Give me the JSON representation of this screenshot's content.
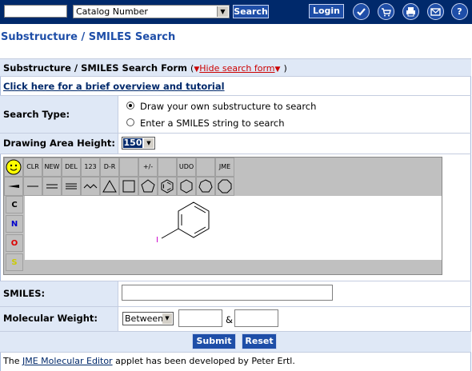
{
  "topbar": {
    "search_value": "",
    "catalog_select": "Catalog Number",
    "search_button": "Search",
    "login_button": "Login",
    "icons": [
      "check-icon",
      "cart-icon",
      "print-icon",
      "mail-icon",
      "help-icon"
    ],
    "help_glyph": "?"
  },
  "page": {
    "title": "Substructure / SMILES Search"
  },
  "form": {
    "header_title": "Substructure / SMILES Search Form",
    "header_open_paren": "(",
    "hide_link": "Hide search form",
    "header_close_paren": ")",
    "tutorial_link": "Click here for a brief overview and tutorial",
    "search_type_label": "Search Type:",
    "search_type_options": [
      {
        "label": "Draw your own substructure to search",
        "selected": true
      },
      {
        "label": "Enter a SMILES string to search",
        "selected": false
      }
    ],
    "drawing_height_label": "Drawing Area Height:",
    "drawing_height_value": "150",
    "smiles_label": "SMILES:",
    "smiles_value": "",
    "mw_label": "Molecular Weight:",
    "mw_operator": "Between",
    "mw_min": "",
    "mw_and": "&",
    "mw_max": "",
    "submit": "Submit",
    "reset": "Reset"
  },
  "editor": {
    "toolbar_row1": [
      "CLR",
      "NEW",
      "DEL",
      "123",
      "D-R",
      "",
      "+/-",
      "",
      "UDO",
      "",
      "JME"
    ],
    "atoms": [
      "C",
      "N",
      "O",
      "S"
    ],
    "atom_colors": {
      "C": "#000000",
      "N": "#0000cc",
      "O": "#dd0000",
      "S": "#cccc00"
    },
    "molecule_atom": "I"
  },
  "footer": {
    "prefix": "The",
    "link": "JME Molecular Editor",
    "suffix": "applet has been developed by Peter Ertl."
  }
}
